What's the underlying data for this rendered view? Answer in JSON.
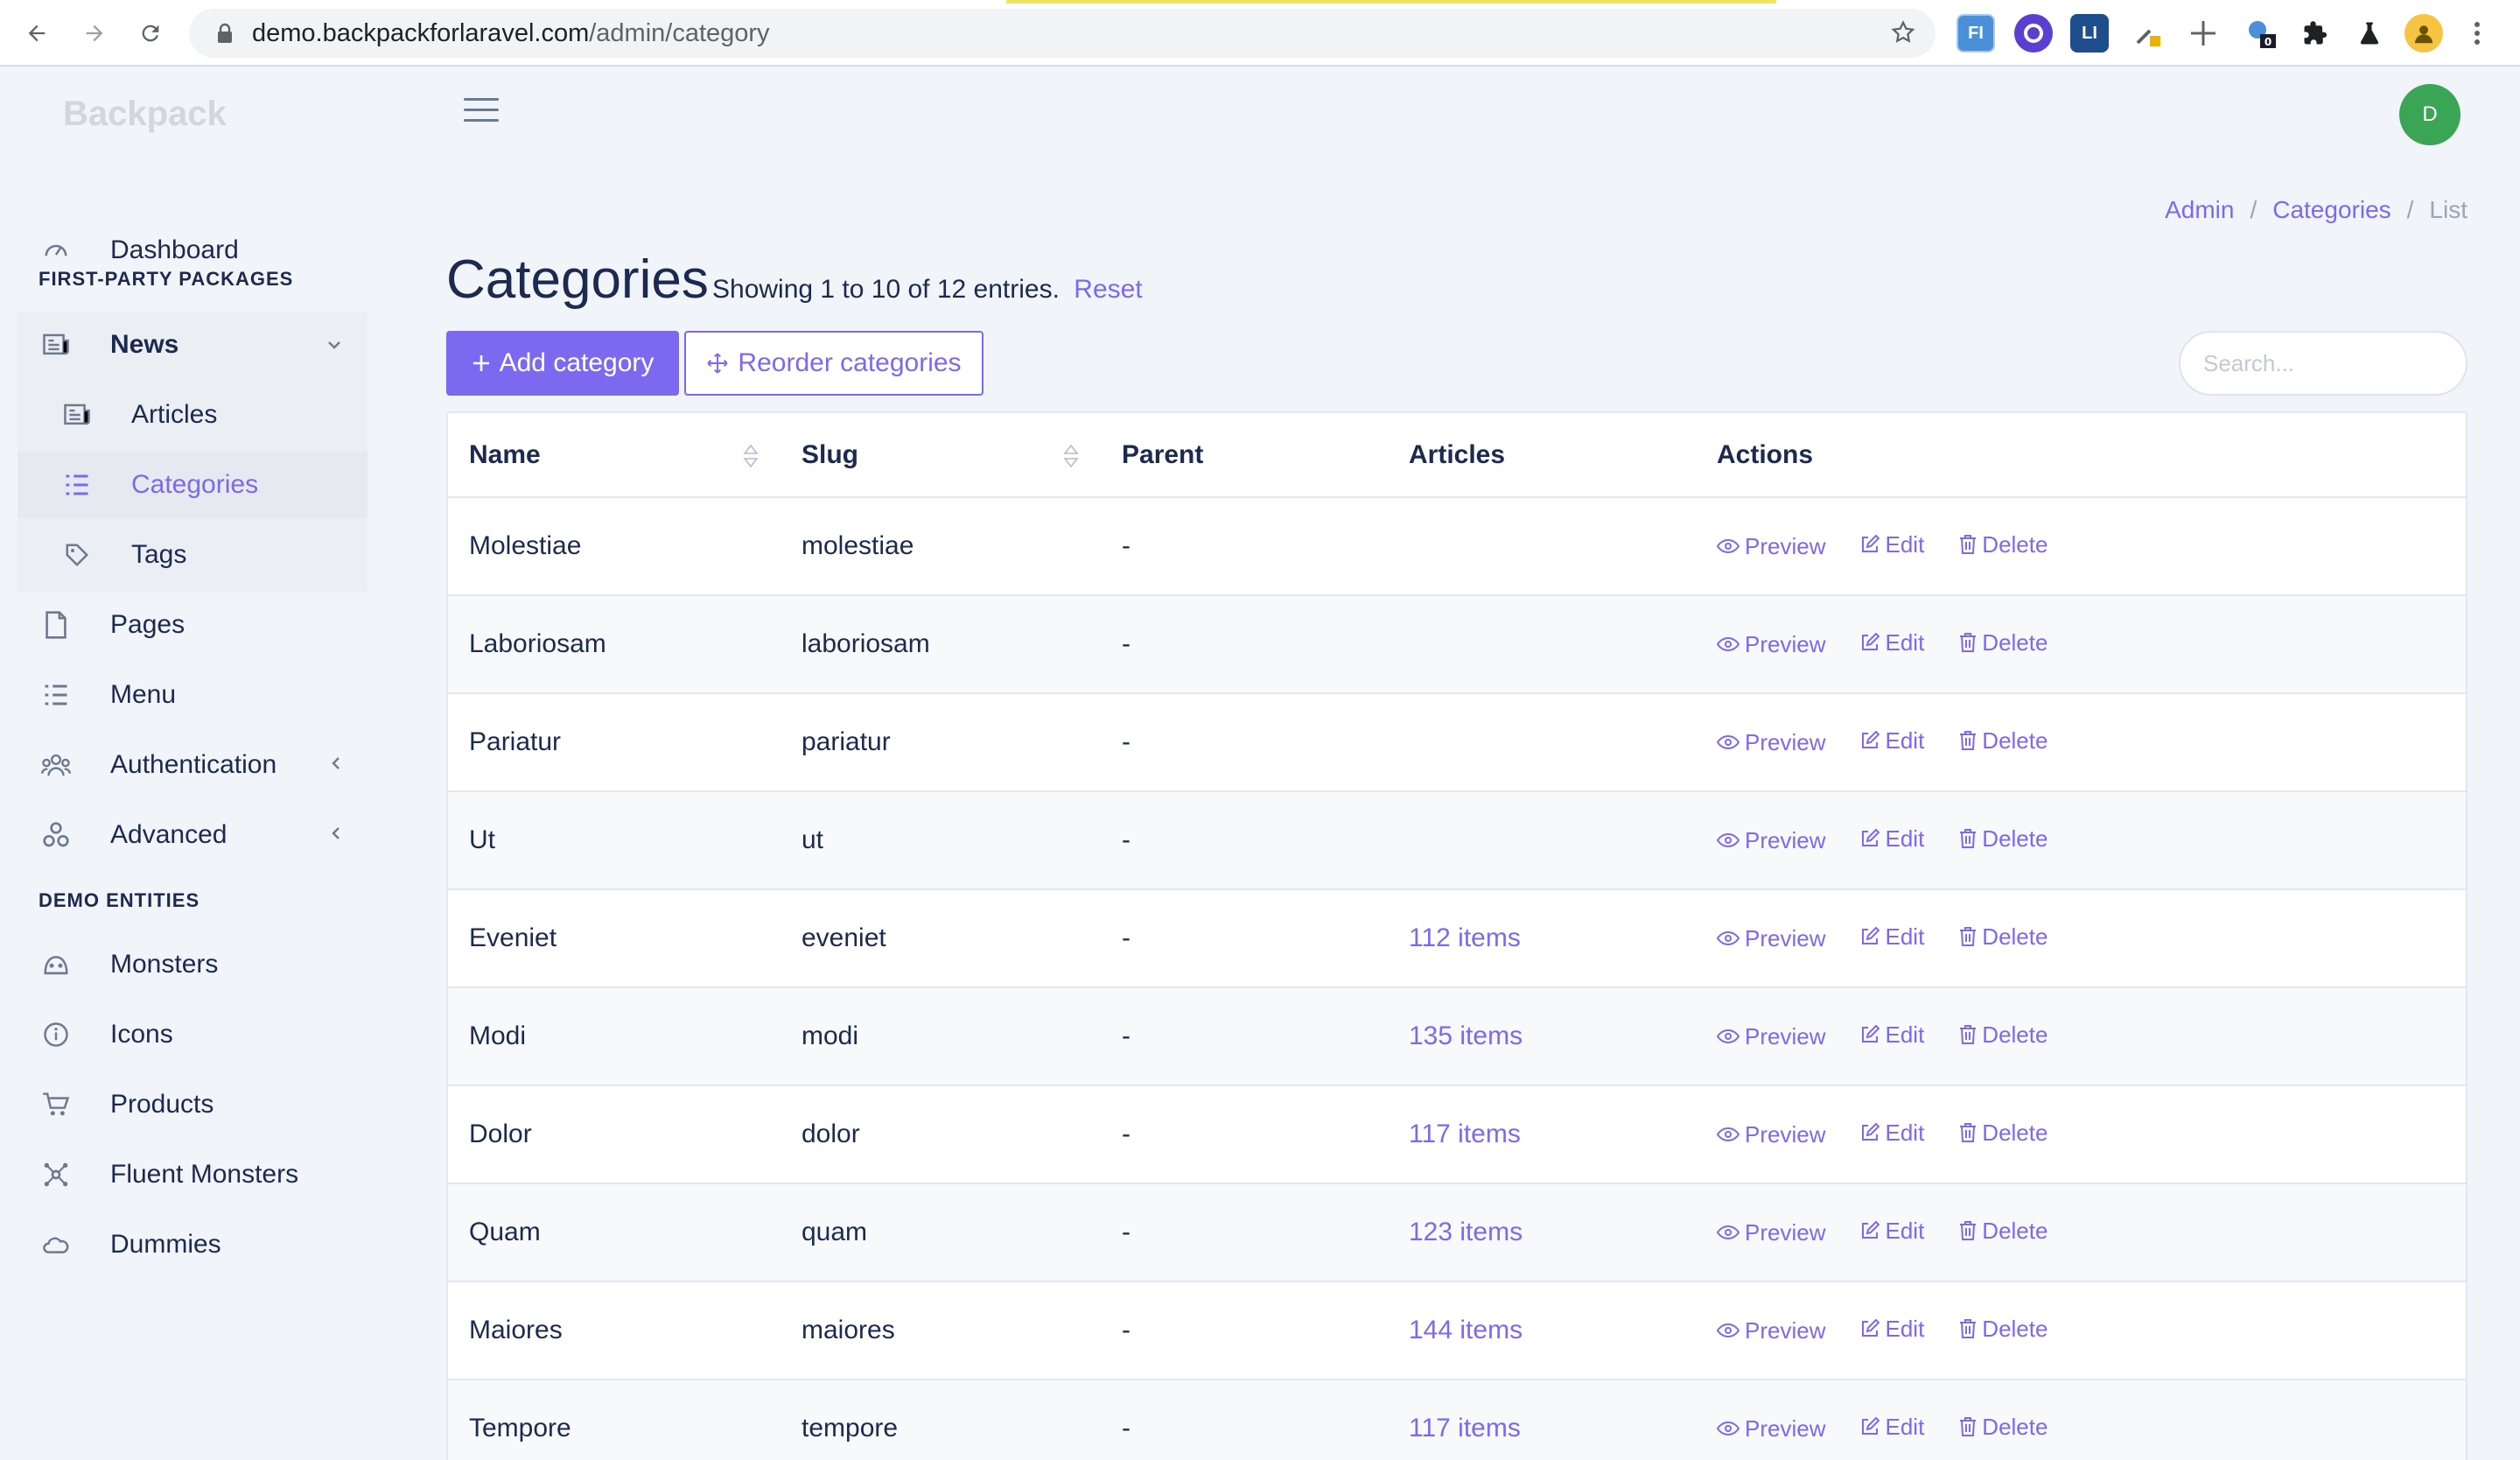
{
  "browser": {
    "url_host": "demo.backpackforlaravel.com",
    "url_path": "/admin/category",
    "extensions": [
      {
        "name": "fi-extension-icon",
        "label": "FI",
        "color": "#4a90d9"
      },
      {
        "name": "color-picker-extension-icon",
        "label": "",
        "color": "#5b3fd1"
      },
      {
        "name": "li-extension-icon",
        "label": "LI",
        "color": "#1f4e8c"
      },
      {
        "name": "eyedropper-extension-icon",
        "label": "",
        "color": "#e8b400"
      },
      {
        "name": "ruler-extension-icon",
        "label": "",
        "color": "#5f6368"
      },
      {
        "name": "badge-extension-icon",
        "label": "0",
        "color": "#4a90d9"
      },
      {
        "name": "puzzle-extension-icon",
        "label": "",
        "color": "#202124"
      },
      {
        "name": "flask-extension-icon",
        "label": "",
        "color": "#202124"
      }
    ]
  },
  "sidebar": {
    "brand": "Backpack",
    "dashboard": "Dashboard",
    "section_first_party": "FIRST-PARTY PACKAGES",
    "news": "News",
    "articles": "Articles",
    "categories": "Categories",
    "tags": "Tags",
    "pages": "Pages",
    "menu": "Menu",
    "authentication": "Authentication",
    "advanced": "Advanced",
    "section_demo": "DEMO ENTITIES",
    "monsters": "Monsters",
    "icons": "Icons",
    "products": "Products",
    "fluent_monsters": "Fluent Monsters",
    "dummies": "Dummies"
  },
  "header": {
    "avatar_initial": "D",
    "breadcrumb": [
      "Admin",
      "Categories",
      "List"
    ],
    "separator": "/"
  },
  "page": {
    "title": "Categories",
    "entries_info": "Showing 1 to 10 of 12 entries.",
    "reset": "Reset",
    "add_button": "Add category",
    "reorder_button": "Reorder categories",
    "search_placeholder": "Search..."
  },
  "table": {
    "columns": [
      "Name",
      "Slug",
      "Parent",
      "Articles",
      "Actions"
    ],
    "actions": {
      "preview": "Preview",
      "edit": "Edit",
      "delete": "Delete"
    },
    "rows": [
      {
        "name": "Molestiae",
        "slug": "molestiae",
        "parent": "-",
        "articles": ""
      },
      {
        "name": "Laboriosam",
        "slug": "laboriosam",
        "parent": "-",
        "articles": ""
      },
      {
        "name": "Pariatur",
        "slug": "pariatur",
        "parent": "-",
        "articles": ""
      },
      {
        "name": "Ut",
        "slug": "ut",
        "parent": "-",
        "articles": ""
      },
      {
        "name": "Eveniet",
        "slug": "eveniet",
        "parent": "-",
        "articles": "112 items"
      },
      {
        "name": "Modi",
        "slug": "modi",
        "parent": "-",
        "articles": "135 items"
      },
      {
        "name": "Dolor",
        "slug": "dolor",
        "parent": "-",
        "articles": "117 items"
      },
      {
        "name": "Quam",
        "slug": "quam",
        "parent": "-",
        "articles": "123 items"
      },
      {
        "name": "Maiores",
        "slug": "maiores",
        "parent": "-",
        "articles": "144 items"
      },
      {
        "name": "Tempore",
        "slug": "tempore",
        "parent": "-",
        "articles": "117 items"
      }
    ]
  },
  "colors": {
    "accent": "#7c69ef",
    "text": "#1b2a4e",
    "avatar": "#3aa655"
  }
}
